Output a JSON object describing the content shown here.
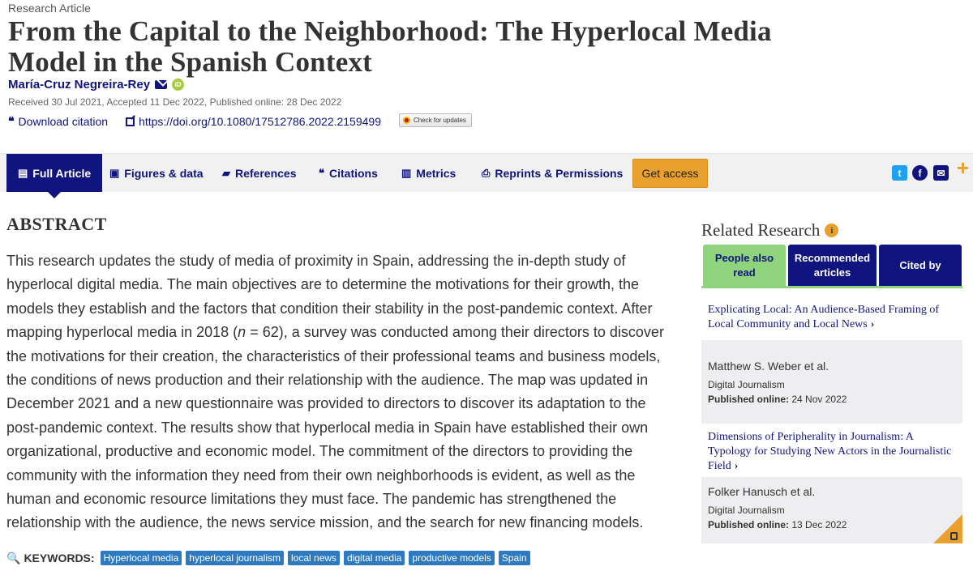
{
  "article": {
    "type": "Research Article",
    "title": "From the Capital to the Neighborhood: The Hyperlocal Media Model in the Spanish Context",
    "author": "María-Cruz Negreira-Rey",
    "dates": "Received 30 Jul 2021, Accepted 11 Dec 2022, Published online: 28 Dec 2022",
    "download_citation": "Download citation",
    "doi": "https://doi.org/10.1080/17512786.2022.2159499",
    "check_updates": "Check for updates"
  },
  "tabs": [
    {
      "label": "Full Article",
      "icon": "document-icon"
    },
    {
      "label": "Figures & data",
      "icon": "image-icon"
    },
    {
      "label": "References",
      "icon": "book-icon"
    },
    {
      "label": "Citations",
      "icon": "quote-icon"
    },
    {
      "label": "Metrics",
      "icon": "bar-chart-icon"
    },
    {
      "label": "Reprints & Permissions",
      "icon": "print-icon"
    }
  ],
  "get_access": "Get access",
  "abstract": {
    "heading": "ABSTRACT",
    "text_before_n": "This research updates the study of media of proximity in Spain, addressing the in-depth study of hyperlocal digital media. The main objectives are to determine the motivations for their growth, the models they establish and the factors that condition their stability in the post-pandemic context. After mapping hyperlocal media in 2018 (",
    "n": "n",
    "text_after_n": " = 62), a survey was conducted among their directors to discover the motivations for their creation, the characteristics of their professional teams and business models, the conditions of news production and their relationship with the audience. The map was updated in December 2021 and a new questionnaire was provided to directors to discover its adaptation to the post-pandemic context. The results show that hyperlocal media in Spain have established their own organizational, productive and economic model. The commitment of the directors to providing the community with the information they need from their own neighborhoods is evident, as well as the human and economic resource limitations they must face. The pandemic has strengthened the relationship with the audience, the news service mission, and the search for new financing models."
  },
  "keywords": {
    "label": "KEYWORDS:",
    "items": [
      "Hyperlocal media",
      "hyperlocal journalism",
      "local news",
      "digital media",
      "productive models",
      "Spain"
    ]
  },
  "related": {
    "heading": "Related Research",
    "tabs": [
      {
        "label1": "People also",
        "label2": "read"
      },
      {
        "label1": "Recommended",
        "label2": "articles"
      },
      {
        "label1": "Cited by",
        "label2": ""
      }
    ],
    "cards": [
      {
        "title": "Explicating Local: An Audience-Based Framing of Local Community and Local News",
        "author": "Matthew S. Weber et al.",
        "journal": "Digital Journalism",
        "published_label": "Published online:",
        "published_date": "24 Nov 2022"
      },
      {
        "title": "Dimensions of Peripherality in Journalism: A Typology for Studying New Actors in the Journalistic Field",
        "author": "Folker Hanusch et al.",
        "journal": "Digital Journalism",
        "published_label": "Published online:",
        "published_date": "13 Dec 2022"
      }
    ]
  },
  "colors": {
    "brand": "#10147e",
    "accent": "#e9a12e",
    "active_tab_green": "#8fd47c",
    "keyword_chip": "#2e7ac0"
  }
}
